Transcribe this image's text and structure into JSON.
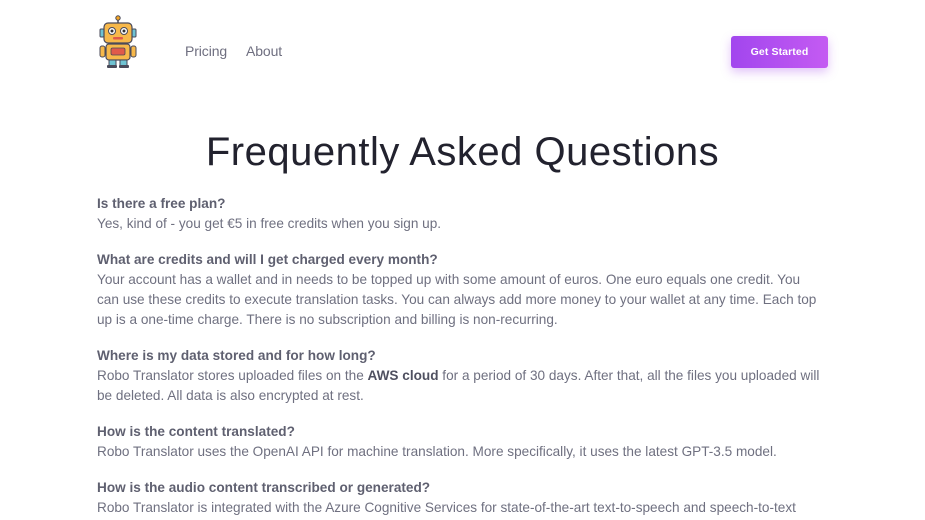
{
  "header": {
    "logo_icon": "robot-logo-icon",
    "nav": [
      {
        "label": "Pricing"
      },
      {
        "label": "About"
      }
    ],
    "cta_label": "Get Started",
    "cta_color": "#b150f0"
  },
  "main": {
    "title": "Frequently Asked Questions",
    "faq": [
      {
        "question": "Is there a free plan?",
        "answer": "Yes, kind of - you get €5 in free credits when you sign up."
      },
      {
        "question": "What are credits and will I get charged every month?",
        "answer": "Your account has a wallet and in needs to be topped up with some amount of euros. One euro equals one credit. You can use these credits to execute translation tasks. You can always add more money to your wallet at any time. Each top up is a one-time charge. There is no subscription and billing is non-recurring."
      },
      {
        "question": "Where is my data stored and for how long?",
        "answer_before": "Robo Translator stores uploaded files on the ",
        "answer_bold": "AWS cloud",
        "answer_after": " for a period of 30 days. After that, all the files you uploaded will be deleted. All data is also encrypted at rest."
      },
      {
        "question": "How is the content translated?",
        "answer": "Robo Translator uses the OpenAI API for machine translation. More specifically, it uses the latest GPT-3.5 model."
      },
      {
        "question": "How is the audio content transcribed or generated?",
        "answer": "Robo Translator is integrated with the Azure Cognitive Services for state-of-the-art text-to-speech and speech-to-text"
      }
    ]
  }
}
